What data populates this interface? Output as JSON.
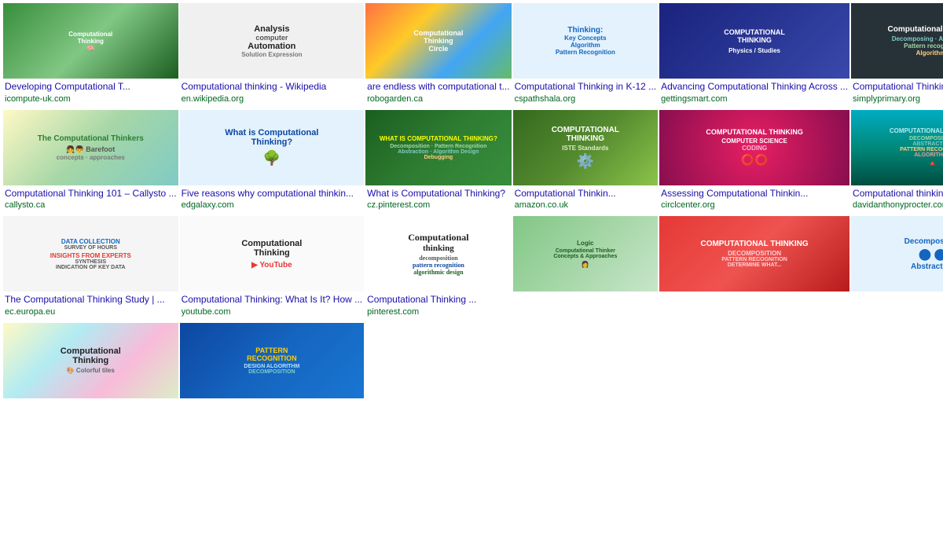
{
  "grid": {
    "rows": [
      {
        "cards": [
          {
            "id": "r1c1",
            "title": "Developing Computational T...",
            "domain": "icompute-uk.com",
            "img_label": "Computational Thinking\nBrain Diagram",
            "img_bg": "#c8e6c9",
            "img_text_color": "#1b5e20"
          },
          {
            "id": "r1c2",
            "title": "Computational thinking - Wikipedia",
            "domain": "en.wikipedia.org",
            "img_label": "Analysis\nAutomation\nComputer",
            "img_bg": "#f5f5f5",
            "img_text_color": "#333"
          },
          {
            "id": "r1c3",
            "title": "are endless with computational t...",
            "domain": "robogarden.ca",
            "img_label": "Computational Thinking\nCircle Diagram",
            "img_bg": "#fff8e1",
            "img_text_color": "#555"
          },
          {
            "id": "r1c4",
            "title": "Computational Thinking in K-12 ...",
            "domain": "cspathshala.org",
            "img_label": "Thinking:\nKey Concepts\nAlgorithm\nPattern Recognition",
            "img_bg": "#e3f2fd",
            "img_text_color": "#1565c0"
          },
          {
            "id": "r1c5",
            "title": "Advancing Computational Thinking Across ...",
            "domain": "gettingsmart.com",
            "img_label": "COMPUTATIONAL\nTHINKING\nPhysics",
            "img_bg": "#e8eaf6",
            "img_text_color": "#1a237e"
          }
        ]
      },
      {
        "cards": [
          {
            "id": "r2c1",
            "title": "Computational Thinking ...",
            "domain": "simplyprimary.org",
            "img_label": "Decomposing\nAbstraction\nPattern recognition\nAlgorithms",
            "img_bg": "#263238",
            "img_text_color": "#fff"
          },
          {
            "id": "r2c2",
            "title": "Computational Thinking 101 – Callysto ...",
            "domain": "callysto.ca",
            "img_label": "The Computational Thinkers\nBarefoot",
            "img_bg": "#e8f5e9",
            "img_text_color": "#1b5e20"
          },
          {
            "id": "r2c3",
            "title": "Five reasons why computational thinkin...",
            "domain": "edgalaxy.com",
            "img_label": "What is Computational\nThinking?\nBrain Tree",
            "img_bg": "#e3f2fd",
            "img_text_color": "#1565c0"
          },
          {
            "id": "r2c4",
            "title": "What is Computational Thinking?",
            "domain": "cz.pinterest.com",
            "img_label": "WHAT IS COMPUTATIONAL\nTHINKING?\nDecomposition\nPattern Recognition\nAbstraction\nAlgorithm Design\nDebugging",
            "img_bg": "#1a237e",
            "img_text_color": "#fff"
          },
          {
            "id": "r2c5",
            "title": "Computational Thinkin...",
            "domain": "amazon.co.uk",
            "img_label": "COMPUTATIONAL\nTHINKING\nISTE",
            "img_bg": "#33691e",
            "img_text_color": "#fff"
          }
        ]
      },
      {
        "cards": [
          {
            "id": "r3c1",
            "title": "Assessing Computational Thinkin...",
            "domain": "circlcenter.org",
            "img_label": "COMPUTATIONAL\nTHINKING\nCOMPUTER\nSCIENCE\nCODING",
            "img_bg": "#880e4f",
            "img_text_color": "#fff"
          },
          {
            "id": "r3c2",
            "title": "Computational thinking – some nice ...",
            "domain": "davidanthonyprocter.com",
            "img_label": "COMPUTATIONAL THINKING\nPyramid\nDecomposition\nAbstraction\nPattern Recognition\nAlgorithms",
            "img_bg": "#00695c",
            "img_text_color": "#fff"
          },
          {
            "id": "r3c3",
            "title": "The Computational Thinking Study | ...",
            "domain": "ec.europa.eu",
            "img_label": "DATA COLLECTION\nSURVEY\nSYNTHESIS\nINDICATION OF KEY DATA",
            "img_bg": "#e3f2fd",
            "img_text_color": "#333"
          },
          {
            "id": "r3c4",
            "title": "Computational Thinking: What Is It? How ...",
            "domain": "youtube.com",
            "img_label": "Computational\nThinking\nWhiteboard",
            "img_bg": "#fff",
            "img_text_color": "#333"
          },
          {
            "id": "r3c5",
            "title": "Computational Thinking ...",
            "domain": "pinterest.com",
            "img_label": "Computational\nthinking\ndecomposition\npattern recognition\nalgorithmic design",
            "img_bg": "#fafafa",
            "img_text_color": "#333"
          }
        ]
      },
      {
        "cards": [
          {
            "id": "r4c1",
            "title": "",
            "domain": "",
            "img_label": "Logic\nComputational Thinker\nConcepts & Approaches",
            "img_bg": "#e8f5e9",
            "img_text_color": "#1b5e20"
          },
          {
            "id": "r4c2",
            "title": "",
            "domain": "",
            "img_label": "COMPUTATIONAL THINKING\nDECOMPOSITION\nPATTERN RECOGNITION\nDETERMINE WHAT...",
            "img_bg": "#e53935",
            "img_text_color": "#fff"
          },
          {
            "id": "r4c3",
            "title": "",
            "domain": "",
            "img_label": "Decomposition\nAbstraction\nCircle Diagram",
            "img_bg": "#e3f2fd",
            "img_text_color": "#333"
          },
          {
            "id": "r4c4",
            "title": "",
            "domain": "",
            "img_label": "Computational\nThinking",
            "img_bg": "#fafafa",
            "img_text_color": "#333"
          },
          {
            "id": "r4c5",
            "title": "",
            "domain": "",
            "img_label": "PATTERN\nRECOGNITION\nDESIGN\nALGORITHM\nDECOMPOSITION",
            "img_bg": "#0d47a1",
            "img_text_color": "#fff"
          }
        ]
      }
    ]
  }
}
